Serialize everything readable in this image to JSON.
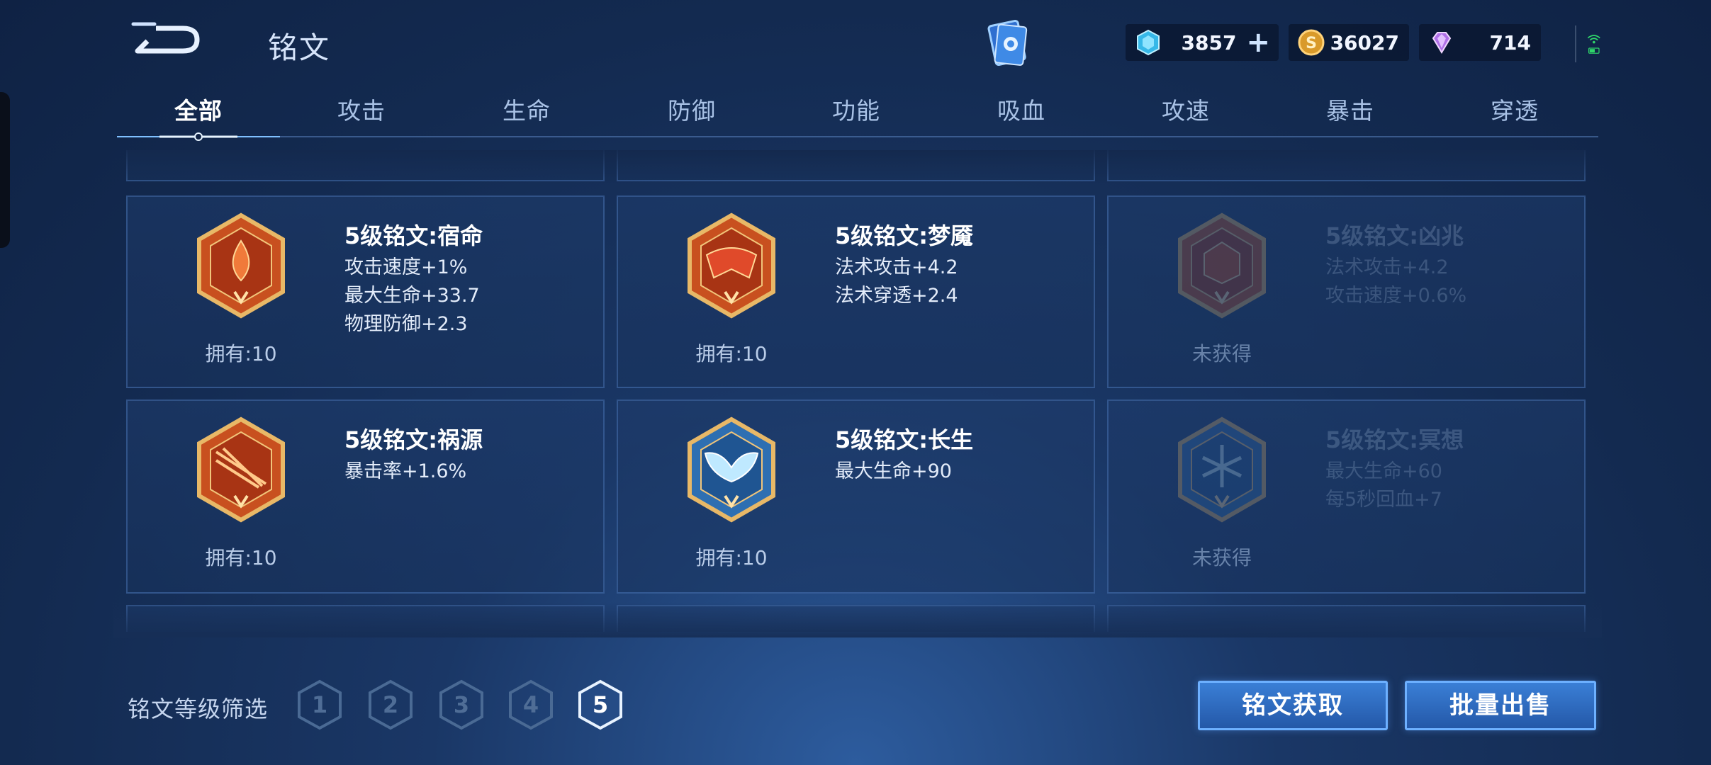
{
  "header": {
    "title": "铭文",
    "currencies": {
      "gem": "3857",
      "gold": "36027",
      "crystal": "714"
    }
  },
  "tabs": [
    {
      "label": "全部",
      "active": true
    },
    {
      "label": "攻击",
      "active": false
    },
    {
      "label": "生命",
      "active": false
    },
    {
      "label": "防御",
      "active": false
    },
    {
      "label": "功能",
      "active": false
    },
    {
      "label": "吸血",
      "active": false
    },
    {
      "label": "攻速",
      "active": false
    },
    {
      "label": "暴击",
      "active": false
    },
    {
      "label": "穿透",
      "active": false
    }
  ],
  "runes": [
    {
      "name": "5级铭文:宿命",
      "stats": [
        "攻击速度+1%",
        "最大生命+33.7",
        "物理防御+2.3"
      ],
      "owned": "拥有:10",
      "locked": false,
      "color": "#d04a1c"
    },
    {
      "name": "5级铭文:梦魇",
      "stats": [
        "法术攻击+4.2",
        "法术穿透+2.4"
      ],
      "owned": "拥有:10",
      "locked": false,
      "color": "#d04a1c"
    },
    {
      "name": "5级铭文:凶兆",
      "stats": [
        "法术攻击+4.2",
        "攻击速度+0.6%"
      ],
      "owned": "未获得",
      "locked": true,
      "color": "#d04a1c"
    },
    {
      "name": "5级铭文:祸源",
      "stats": [
        "暴击率+1.6%"
      ],
      "owned": "拥有:10",
      "locked": false,
      "color": "#d04a1c"
    },
    {
      "name": "5级铭文:长生",
      "stats": [
        "最大生命+90"
      ],
      "owned": "拥有:10",
      "locked": false,
      "color": "#3a8fd0"
    },
    {
      "name": "5级铭文:冥想",
      "stats": [
        "最大生命+60",
        "每5秒回血+7"
      ],
      "owned": "未获得",
      "locked": true,
      "color": "#3a8fd0"
    }
  ],
  "filter": {
    "label": "铭文等级筛选",
    "levels": [
      "1",
      "2",
      "3",
      "4",
      "5"
    ],
    "selected": "5"
  },
  "buttons": {
    "get": "铭文获取",
    "sell": "批量出售"
  },
  "colors": {
    "accent": "#6db0ff",
    "button": "#2f6cc0",
    "background": "#132a50"
  }
}
